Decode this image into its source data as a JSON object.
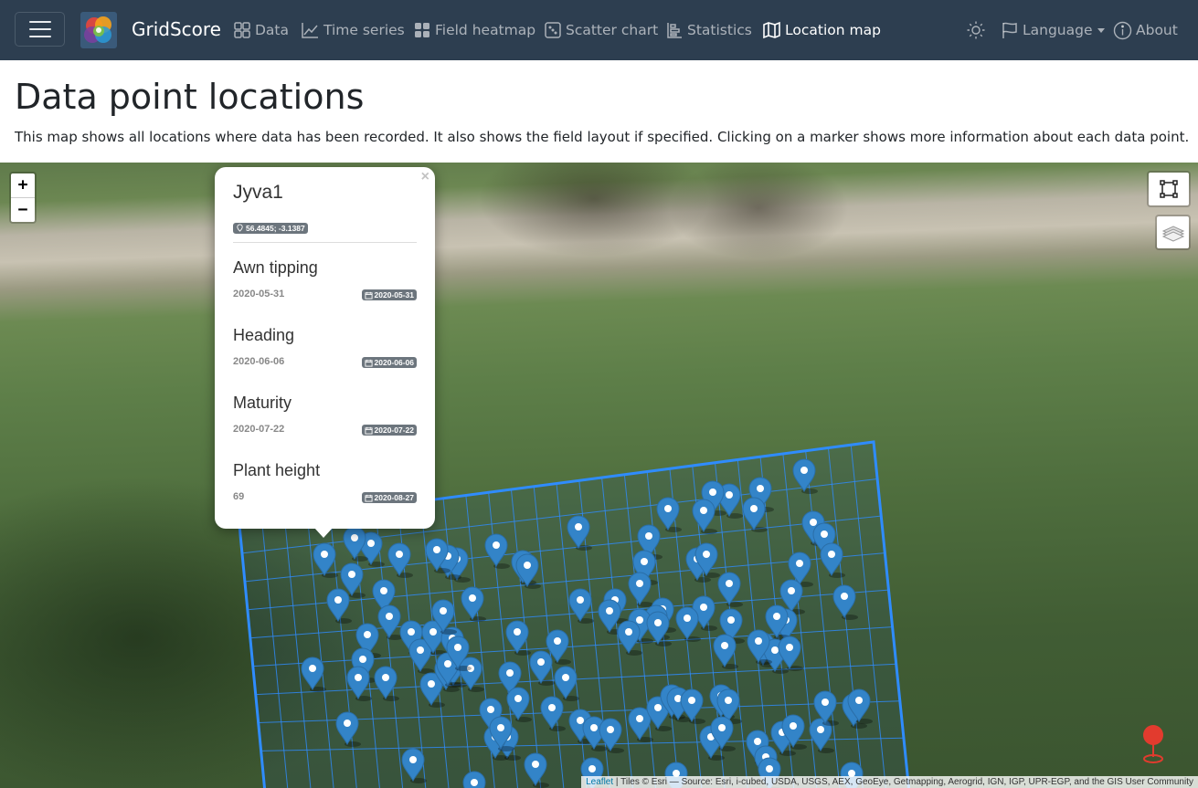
{
  "navbar": {
    "brand": "GridScore",
    "items": [
      {
        "label": "Data",
        "icon": "table-icon"
      },
      {
        "label": "Time series",
        "icon": "chart-line-icon"
      },
      {
        "label": "Field heatmap",
        "icon": "grid-icon"
      },
      {
        "label": "Scatter chart",
        "icon": "scatter-icon"
      },
      {
        "label": "Statistics",
        "icon": "statistics-icon"
      },
      {
        "label": "Location map",
        "icon": "map-icon",
        "active": true
      }
    ],
    "theme_icon": "sun-icon",
    "language": "Language",
    "about": "About"
  },
  "page": {
    "title": "Data point locations",
    "description": "This map shows all locations where data has been recorded. It also shows the field layout if specified. Clicking on a marker shows more information about each data point."
  },
  "map": {
    "zoom_in": "+",
    "zoom_out": "−",
    "popup": {
      "close": "×",
      "title": "Jyva1",
      "coordinates": "56.4845; -3.1387",
      "traits": [
        {
          "name": "Awn tipping",
          "value": "2020-05-31",
          "date": "2020-05-31"
        },
        {
          "name": "Heading",
          "value": "2020-06-06",
          "date": "2020-06-06"
        },
        {
          "name": "Maturity",
          "value": "2020-07-22",
          "date": "2020-07-22"
        },
        {
          "name": "Plant height",
          "value": "69",
          "date": "2020-08-27"
        }
      ]
    },
    "attribution": {
      "link": "Leaflet",
      "text": " | Tiles © Esri — Source: Esri, i-cubed, USDA, USGS, AEX, GeoEye, Getmapping, Aerogrid, IGN, IGP, UPR-EGP, and the GIS User Community"
    },
    "colors": {
      "marker": "#3384c8",
      "field_grid": "#2f8cff",
      "location_marker": "#e23b2e"
    }
  }
}
